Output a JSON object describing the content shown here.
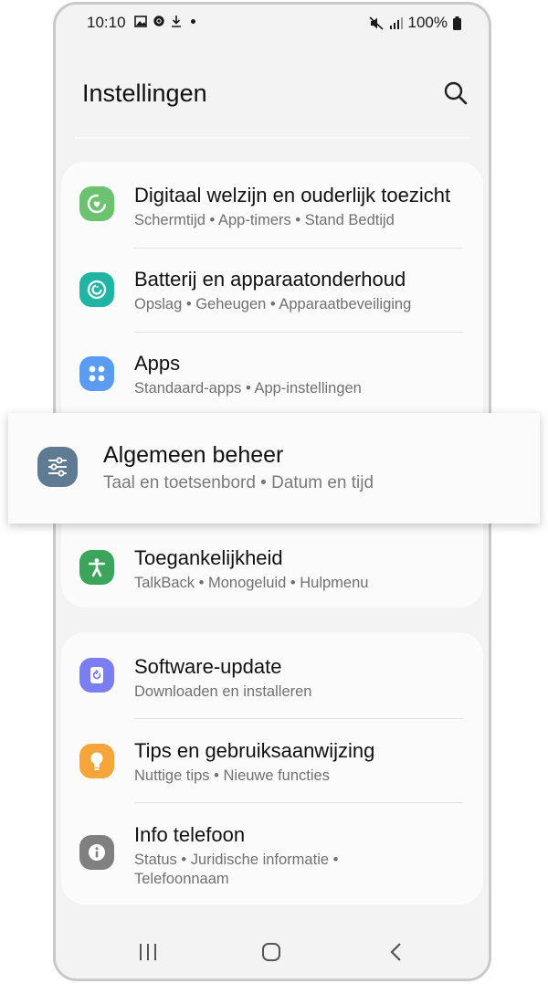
{
  "status_bar": {
    "time": "10:10",
    "battery": "100%"
  },
  "header": {
    "title": "Instellingen"
  },
  "settings": [
    {
      "title": "Digitaal welzijn en ouderlijk toezicht",
      "subtitle": "Schermtijd  •  App-timers  •  Stand Bedtijd",
      "icon": "digital-wellbeing-icon",
      "color": "#6cc36f"
    },
    {
      "title": "Batterij en apparaatonderhoud",
      "subtitle": "Opslag  •  Geheugen  •  Apparaatbeveiliging",
      "icon": "device-care-icon",
      "color": "#1fb5a2"
    },
    {
      "title": "Apps",
      "subtitle": "Standaard-apps  •  App-instellingen",
      "icon": "apps-icon",
      "color": "#5b9cf2"
    },
    {
      "title": "Toegankelijkheid",
      "subtitle": "TalkBack  •  Monogeluid  •  Hulpmenu",
      "icon": "accessibility-icon",
      "color": "#3ca55c"
    },
    {
      "title": "Software-update",
      "subtitle": "Downloaden en installeren",
      "icon": "software-update-icon",
      "color": "#7b7ef0"
    },
    {
      "title": "Tips en gebruiksaanwijzing",
      "subtitle": "Nuttige tips  •  Nieuwe functies",
      "icon": "tips-icon",
      "color": "#f5a53a"
    },
    {
      "title": "Info telefoon",
      "subtitle": "Status  •  Juridische informatie  •  Telefoonnaam",
      "icon": "info-icon",
      "color": "#808080"
    }
  ],
  "highlighted": {
    "title": "Algemeen beheer",
    "subtitle": "Taal en toetsenbord  •  Datum en tijd",
    "icon": "general-management-icon",
    "color": "#5f7a93"
  }
}
